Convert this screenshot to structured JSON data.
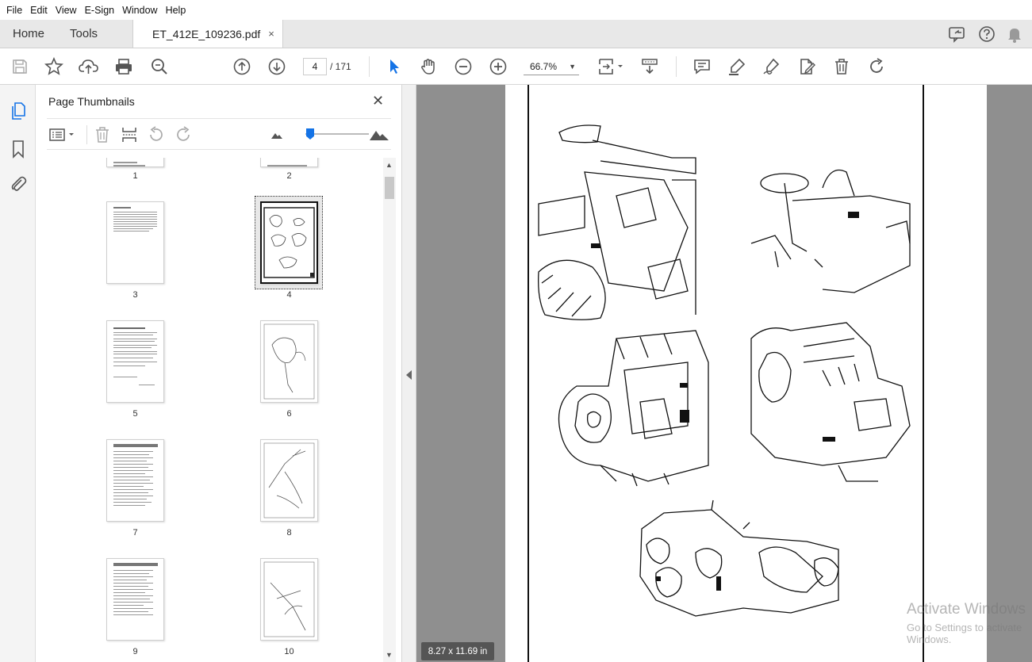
{
  "menubar": {
    "items": [
      "File",
      "Edit",
      "View",
      "E-Sign",
      "Window",
      "Help"
    ]
  },
  "tabs": {
    "home": "Home",
    "tools": "Tools",
    "document": "ET_412E_109236.pdf",
    "close_glyph": "×"
  },
  "toolbar": {
    "current_page": "4",
    "total_pages": "/ 171",
    "zoom": "66.7%"
  },
  "panel": {
    "title": "Page Thumbnails",
    "close_glyph": "✕"
  },
  "thumbnails": {
    "labels": [
      "1",
      "2",
      "3",
      "4",
      "5",
      "6",
      "7",
      "8",
      "9",
      "10"
    ],
    "selected": "4"
  },
  "viewer": {
    "page_size": "8.27 x 11.69 in"
  },
  "watermark": {
    "line1": "Activate Windows",
    "line2": "Go to Settings to activate Windows."
  },
  "colors": {
    "accent": "#1473e6",
    "viewer_bg": "#8f8f8f"
  }
}
